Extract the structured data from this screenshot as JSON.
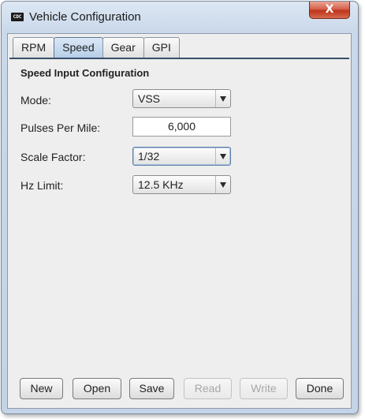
{
  "window": {
    "app_icon_text": "CDC",
    "title": "Vehicle Configuration",
    "close_symbol": "X"
  },
  "tabs": [
    {
      "label": "RPM",
      "active": false
    },
    {
      "label": "Speed",
      "active": true
    },
    {
      "label": "Gear",
      "active": false
    },
    {
      "label": "GPI",
      "active": false
    }
  ],
  "section": {
    "title": "Speed Input Configuration"
  },
  "fields": {
    "mode": {
      "label": "Mode:",
      "value": "VSS"
    },
    "pulses_per_mile": {
      "label": "Pulses Per Mile:",
      "value": "6,000"
    },
    "scale_factor": {
      "label": "Scale Factor:",
      "value": "1/32"
    },
    "hz_limit": {
      "label": "Hz Limit:",
      "value": "12.5 KHz"
    }
  },
  "buttons": {
    "new": {
      "label": "New",
      "enabled": true
    },
    "open": {
      "label": "Open",
      "enabled": true
    },
    "save": {
      "label": "Save",
      "enabled": true
    },
    "read": {
      "label": "Read",
      "enabled": false
    },
    "write": {
      "label": "Write",
      "enabled": false
    },
    "done": {
      "label": "Done",
      "enabled": true
    }
  },
  "colors": {
    "window_frame": "#c4d3e6",
    "close_button": "#c1331c",
    "panel_background": "#eeeeee",
    "active_tab": "#b5cfe8"
  }
}
